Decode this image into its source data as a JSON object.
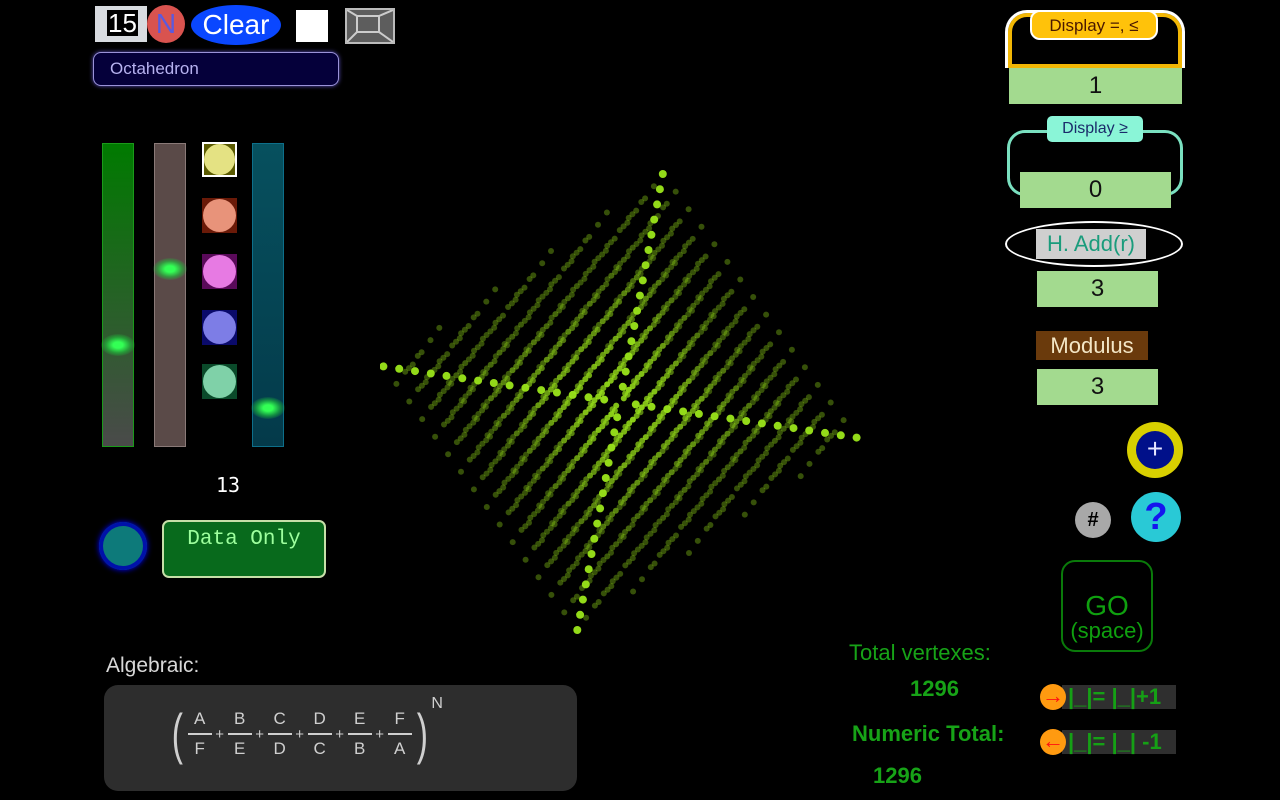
{
  "toolbar": {
    "number_value": "15",
    "n_button": "N",
    "clear_button": "Clear",
    "shape_select": "Octahedron"
  },
  "sliders": [
    {
      "name": "green",
      "level": 0.66
    },
    {
      "name": "brown",
      "level": 0.41
    },
    {
      "name": "teal",
      "level": 0.87
    }
  ],
  "swatches": [
    {
      "fill": "#e4e283",
      "bg": "#5a5a00",
      "selected": true
    },
    {
      "fill": "#e8937a",
      "bg": "#6a1a08",
      "selected": false
    },
    {
      "fill": "#e77ae3",
      "bg": "#5a0a5a",
      "selected": false
    },
    {
      "fill": "#7d7de6",
      "bg": "#0a0a6a",
      "selected": false
    },
    {
      "fill": "#7fd1a8",
      "bg": "#0a4a2a",
      "selected": false
    }
  ],
  "count_label": "13",
  "data_only_button": "Data Only",
  "algebraic": {
    "label": "Algebraic:",
    "numerators": [
      "A",
      "B",
      "C",
      "D",
      "E",
      "F"
    ],
    "denominators": [
      "F",
      "E",
      "D",
      "C",
      "B",
      "A"
    ],
    "exponent": "N"
  },
  "right_panel": {
    "display_le_label": "Display =, ≤",
    "display_le_value": "1",
    "display_ge_label": "Display ≥",
    "display_ge_value": "0",
    "hadd_label": "H. Add(r)",
    "hadd_value": "3",
    "modulus_label": "Modulus",
    "modulus_value": "3",
    "plus_button": "+",
    "hash_button": "#",
    "help_button": "?",
    "go_label": "GO",
    "go_sub": "(space)"
  },
  "stats": {
    "total_vertexes_label": "Total vertexes:",
    "total_vertexes_value": "1296",
    "numeric_total_label": "Numeric Total:",
    "numeric_total_value": "1296"
  },
  "steppers": {
    "up_icon": "→",
    "up_label": "|_|= |_|+1",
    "down_icon": "←",
    "down_label": "|_|= |_| -1"
  },
  "visualization": {
    "shape": "octahedron",
    "point_color": "#9be61a"
  }
}
